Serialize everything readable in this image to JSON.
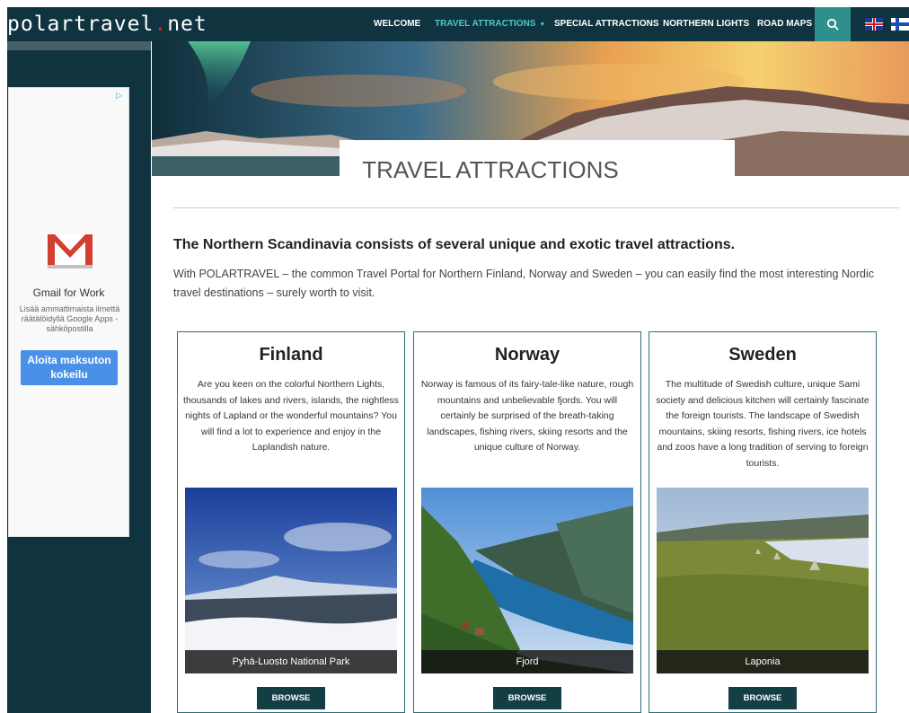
{
  "site": {
    "logo_main": "polartravel",
    "logo_dot": ".",
    "logo_suffix": "net"
  },
  "nav": {
    "items": [
      {
        "label": "WELCOME"
      },
      {
        "label": "TRAVEL ATTRACTIONS",
        "active": true
      },
      {
        "label": "SPECIAL ATTRACTIONS"
      },
      {
        "label": "NORTHERN LIGHTS"
      },
      {
        "label": "ROAD MAPS"
      }
    ],
    "caret": "▼",
    "search_icon": "search-icon",
    "languages": [
      "flag-uk-icon",
      "flag-finland-icon"
    ]
  },
  "ad": {
    "title": "Gmail for Work",
    "text": "Lisää ammattimaista ilmettä räätälöidyllä Google Apps -sähköpostilla",
    "button": "Aloita maksuton kokeilu",
    "choice": "▷"
  },
  "page": {
    "title": "TRAVEL ATTRACTIONS",
    "heading": "The Northern Scandinavia consists of several unique and exotic travel attractions.",
    "intro": "With POLARTRAVEL – the common Travel Portal for Northern Finland, Norway and Sweden – you can easily find the most interesting Nordic travel destinations – surely worth to visit."
  },
  "cards": [
    {
      "title": "Finland",
      "text": "Are you keen on the colorful Northern Lights, thousands of lakes and rivers, islands, the nightless nights of Lapland or the wonderful mountains? You will find a lot to experience and enjoy in the Laplandish nature.",
      "caption": "Pyhä-Luosto National Park",
      "button": "BROWSE"
    },
    {
      "title": "Norway",
      "text": "Norway is famous of its fairy-tale-like nature, rough mountains and unbelievable fjords. You will certainly be surprised of the breath-taking landscapes, fishing rivers, skiing resorts and the unique culture of Norway.",
      "caption": "Fjord",
      "button": "BROWSE"
    },
    {
      "title": "Sweden",
      "text": "The multitude of Swedish culture, unique Sami society and delicious kitchen will certainly fascinate the foreign tourists. The landscape of Swedish mountains, skiing resorts, fishing rivers, ice hotels and zoos have a long tradition of serving to foreign tourists.",
      "caption": "Laponia",
      "button": "BROWSE"
    }
  ],
  "colors": {
    "nav_bg": "#0f3440",
    "nav_active": "#4ec9c0",
    "accent": "#2f8f8c",
    "button_bg": "#123e44",
    "logo_dot": "#e2231a"
  }
}
